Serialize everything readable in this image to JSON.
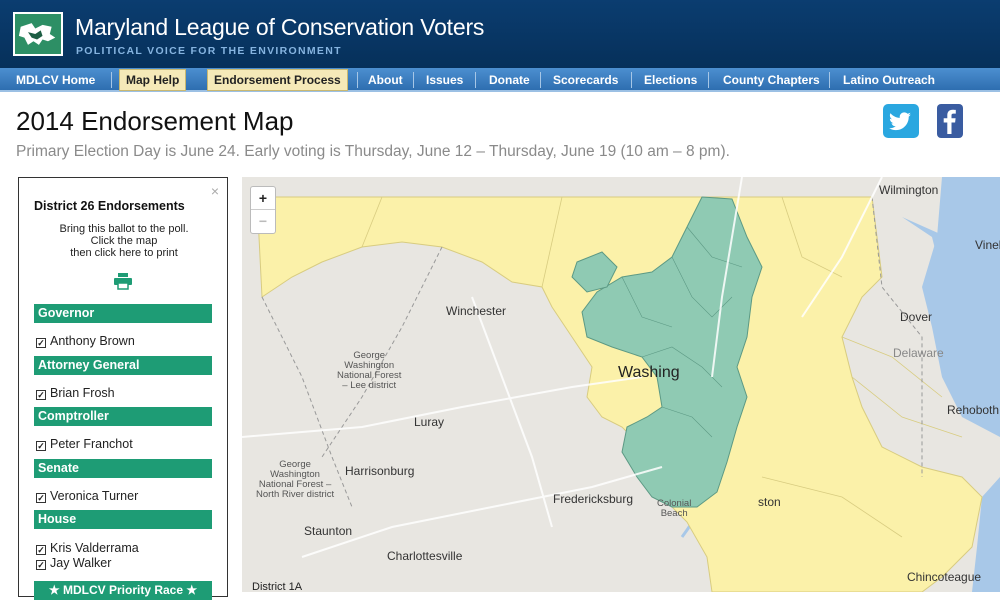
{
  "header": {
    "title": "Maryland League of Conservation Voters",
    "tagline": "POLITICAL VOICE FOR THE ENVIRONMENT",
    "logo_icon": "maryland-logo-icon"
  },
  "nav": {
    "items": [
      {
        "label": "MDLCV Home",
        "highlight": false
      },
      {
        "label": "Map Help",
        "highlight": true
      },
      {
        "label": "Endorsement Process",
        "highlight": true
      },
      {
        "label": "About",
        "highlight": false
      },
      {
        "label": "Issues",
        "highlight": false
      },
      {
        "label": "Donate",
        "highlight": false
      },
      {
        "label": "Scorecards",
        "highlight": false
      },
      {
        "label": "Elections",
        "highlight": false
      },
      {
        "label": "County Chapters",
        "highlight": false
      },
      {
        "label": "Latino Outreach",
        "highlight": false
      }
    ]
  },
  "page": {
    "title": "2014 Endorsement Map",
    "subtitle": "Primary Election Day is June 24. Early voting is Thursday, June 12 – Thursday, June 19 (10 am – 8 pm)."
  },
  "share": {
    "twitter_icon": "twitter-icon",
    "facebook_icon": "facebook-icon"
  },
  "ballot": {
    "close": "×",
    "title": "District 26 Endorsements",
    "instructions": [
      "Bring this ballot to the poll.",
      "Click the map",
      "then click here to print"
    ],
    "print_icon": "printer-icon",
    "sections": [
      {
        "label": "Governor",
        "candidates": [
          "Anthony Brown"
        ]
      },
      {
        "label": "Attorney General",
        "candidates": [
          "Brian Frosh"
        ]
      },
      {
        "label": "Comptroller",
        "candidates": [
          "Peter Franchot"
        ]
      },
      {
        "label": "Senate",
        "candidates": [
          "Veronica Turner"
        ]
      },
      {
        "label": "House",
        "candidates": [
          "Kris Valderrama",
          "Jay Walker"
        ]
      }
    ],
    "priority": "★ MDLCV Priority Race ★",
    "check_glyph": "✓"
  },
  "map": {
    "zoom_in": "+",
    "zoom_out": "−",
    "labels": {
      "wilmington": "Wilmington",
      "vineland": "Vinel",
      "winchester": "Winchester",
      "dover": "Dover",
      "delaware": "Delaware",
      "washington": "Washing",
      "gw_forest_1": "George\nWashington\nNational Forest\n– Lee district",
      "luray": "Luray",
      "rehoboth": "Rehoboth",
      "gw_forest_2": "George\nWashington\nNational Forest –\nNorth River district",
      "harrisonburg": "Harrisonburg",
      "fredericksburg": "Fredericksburg",
      "colonial_beach": "Colonial\nBeach",
      "easton": "ston",
      "staunton": "Staunton",
      "charlottesville": "Charlottesville",
      "chincoteague": "Chincoteague",
      "district": "District 1A"
    },
    "colors": {
      "endorsed": "#8fcab3",
      "non_endorsed": "#fbf1a9",
      "water": "#a8c8e8",
      "land": "#e8e6e1"
    }
  }
}
